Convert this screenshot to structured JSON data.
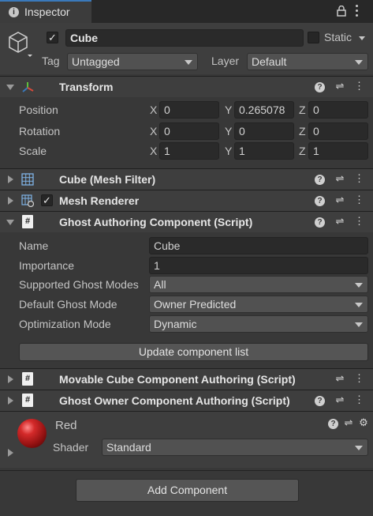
{
  "tab": {
    "title": "Inspector",
    "info_icon": "info-icon",
    "lock_icon": "lock-icon",
    "menu_icon": "kebab-menu-icon"
  },
  "object": {
    "name": "Cube",
    "active": true,
    "static_label": "Static",
    "static": false,
    "tag_label": "Tag",
    "tag_value": "Untagged",
    "layer_label": "Layer",
    "layer_value": "Default",
    "icon": "cube-icon"
  },
  "transform": {
    "title": "Transform",
    "icon": "transform-axes-icon",
    "rows": [
      {
        "label": "Position",
        "x": "0",
        "y": "0.265078",
        "z": "0"
      },
      {
        "label": "Rotation",
        "x": "0",
        "y": "0",
        "z": "0"
      },
      {
        "label": "Scale",
        "x": "1",
        "y": "1",
        "z": "1"
      }
    ],
    "axis_labels": {
      "x": "X",
      "y": "Y",
      "z": "Z"
    }
  },
  "components": {
    "mesh_filter": {
      "title": "Cube (Mesh Filter)",
      "icon": "mesh-filter-icon"
    },
    "mesh_renderer": {
      "title": "Mesh Renderer",
      "icon": "mesh-renderer-icon",
      "enabled": true
    },
    "ghost_authoring": {
      "title": "Ghost Authoring Component (Script)",
      "icon": "script-icon",
      "icon_glyph": "#",
      "fields": {
        "name_label": "Name",
        "name_value": "Cube",
        "importance_label": "Importance",
        "importance_value": "1",
        "supported_label": "Supported Ghost Modes",
        "supported_value": "All",
        "default_label": "Default Ghost Mode",
        "default_value": "Owner Predicted",
        "optimization_label": "Optimization Mode",
        "optimization_value": "Dynamic"
      },
      "update_button": "Update component list"
    },
    "movable_cube": {
      "title": "Movable Cube Component Authoring (Script)",
      "icon": "script-icon"
    },
    "ghost_owner": {
      "title": "Ghost Owner Component Authoring (Script)",
      "icon": "script-icon"
    }
  },
  "material": {
    "name": "Red",
    "shader_label": "Shader",
    "shader_value": "Standard",
    "preview_color": "#b21a1a"
  },
  "header_icons": {
    "help": "?",
    "settings": "preset-sliders-icon",
    "more": "kebab-menu-icon"
  },
  "add_component_button": "Add Component",
  "colors": {
    "accent": "#3a79bb",
    "background": "#383838",
    "header": "#3e3e3e"
  }
}
